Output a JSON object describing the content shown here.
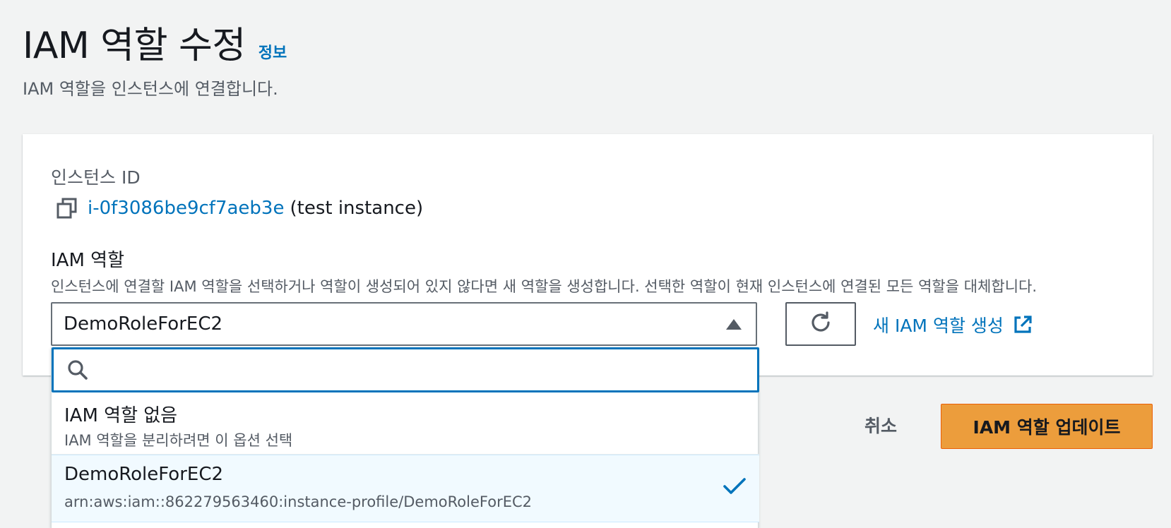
{
  "header": {
    "title": "IAM 역할 수정",
    "info_link": "정보",
    "description": "IAM 역할을 인스턴스에 연결합니다."
  },
  "instance": {
    "label": "인스턴스 ID",
    "id": "i-0f3086be9cf7aeb3e",
    "name": "(test instance)",
    "icon": "copy-icon"
  },
  "role": {
    "label": "IAM 역할",
    "description": "인스턴스에 연결할 IAM 역할을 선택하거나 역할이 생성되어 있지 않다면 새 역할을 생성합니다. 선택한 역할이 현재 인스턴스에 연결된 모든 역할을 대체합니다.",
    "selected_value": "DemoRoleForEC2",
    "refresh_icon": "refresh-icon",
    "new_role_link": "새 IAM 역할 생성",
    "new_role_icon": "external-link-icon"
  },
  "dropdown": {
    "search_placeholder": "",
    "options": [
      {
        "title": "IAM 역할 없음",
        "subtitle": "IAM 역할을 분리하려면 이 옵션 선택",
        "selected": false
      },
      {
        "title": "DemoRoleForEC2",
        "subtitle": "arn:aws:iam::862279563460:instance-profile/DemoRoleForEC2",
        "selected": true
      }
    ]
  },
  "actions": {
    "cancel": "취소",
    "update": "IAM 역할 업데이트"
  },
  "colors": {
    "link": "#0073bb",
    "primary_button": "#ec9d3c",
    "background": "#f2f3f3",
    "selected_row": "#f1faff"
  }
}
